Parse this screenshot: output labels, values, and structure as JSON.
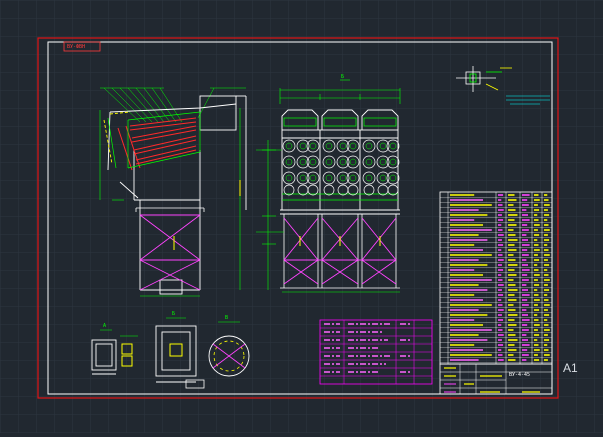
{
  "sheet": {
    "size_label": "A1",
    "drawing_number": "ВУ-ФВН",
    "background": "#212830",
    "grid_color": "#2d3640",
    "border_outer_color": "#e01515",
    "border_inner_color": "#ffffff"
  },
  "views": {
    "view_b_marker": "Б",
    "detail_markers": [
      "А",
      "Б",
      "В"
    ]
  },
  "layers": {
    "structure": "#ffffff",
    "filters": "#00ff00",
    "bags": "#ff2a2a",
    "bracing": "#ff44ff",
    "dimensions": "#ffff00",
    "leaders": "#00ffff",
    "notes": "#ff00ff"
  },
  "title_block": {
    "designation": "ВУ-4-45"
  },
  "icons": [
    "leader-arrow-icon",
    "section-mark-icon"
  ]
}
